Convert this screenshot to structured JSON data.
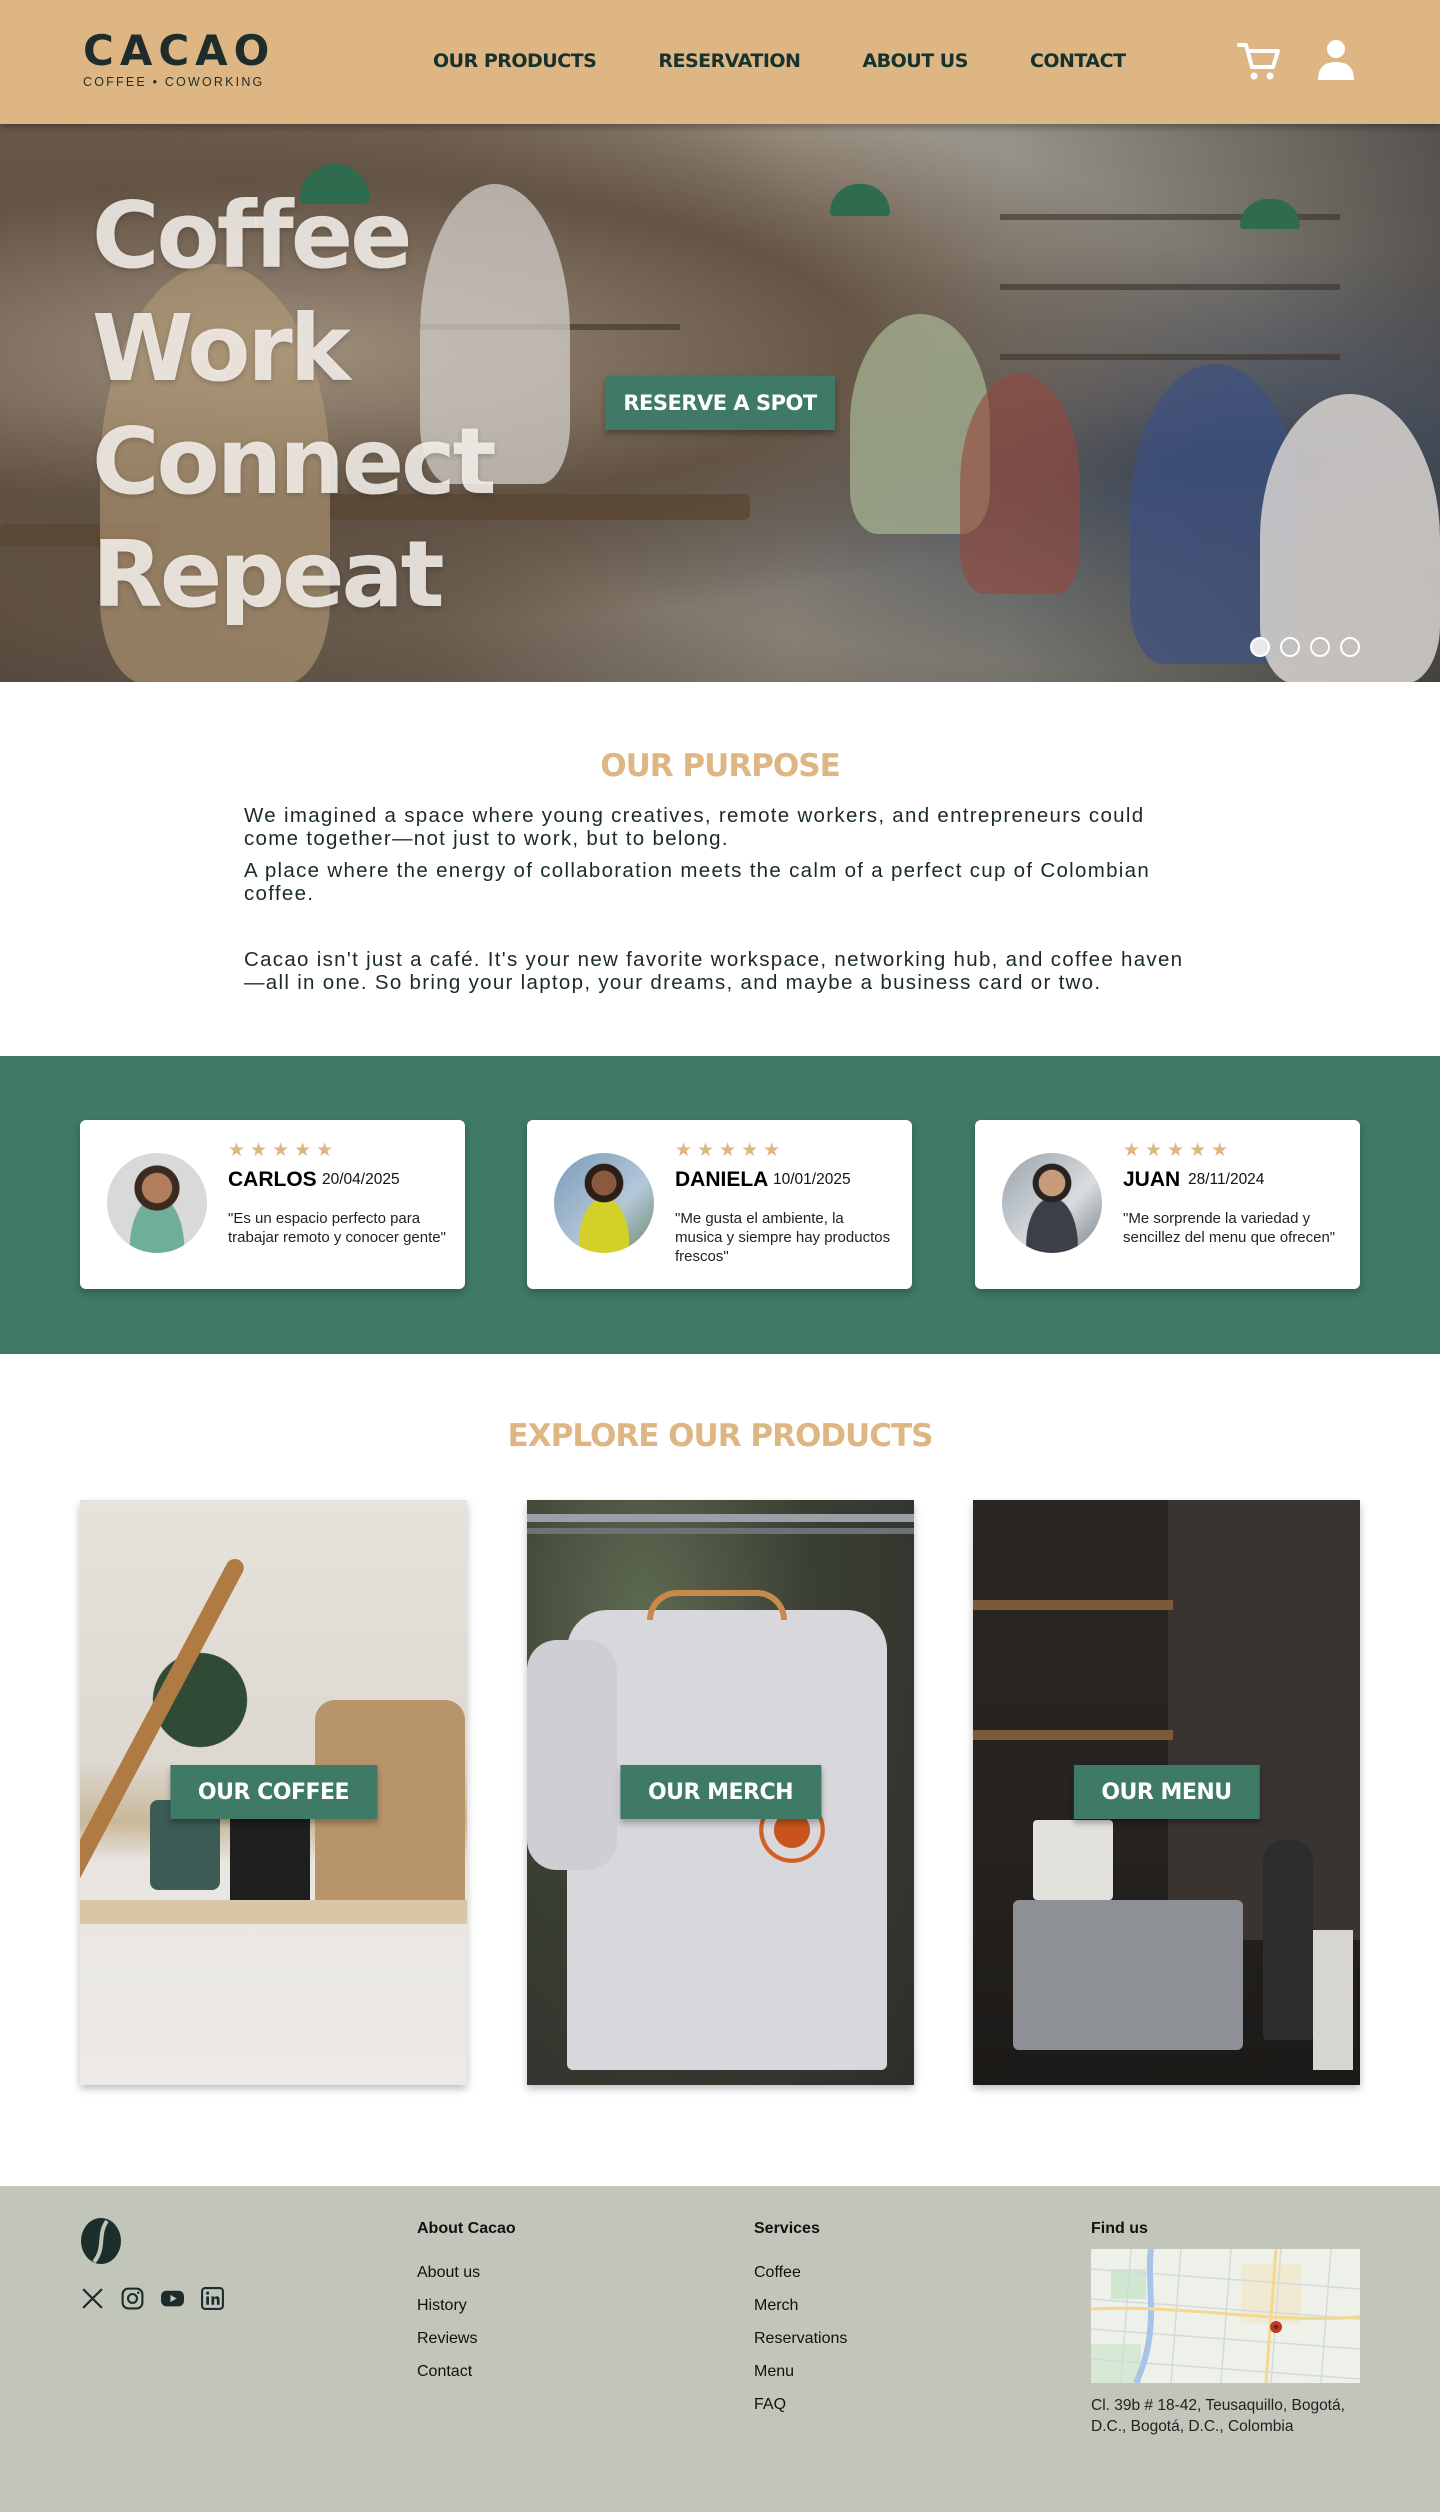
{
  "brand": {
    "name": "CACAO",
    "tagline": "COFFEE • COWORKING"
  },
  "nav": {
    "items": [
      "OUR PRODUCTS",
      "RESERVATION",
      "ABOUT US",
      "CONTACT"
    ]
  },
  "hero": {
    "words": [
      "Coffee",
      "Work",
      "Connect",
      "Repeat"
    ],
    "cta": "RESERVE A SPOT",
    "slides_total": 4,
    "active_slide": 1
  },
  "purpose": {
    "title": "OUR PURPOSE",
    "paragraphs": [
      "We imagined a space where young creatives, remote workers, and entrepreneurs could come together—not just to work, but to belong.",
      "A place where the energy of collaboration meets the calm of a perfect cup of Colombian coffee.",
      "Cacao isn't just a café. It's your new favorite workspace, networking hub, and coffee haven—all in one. So bring your laptop, your dreams, and maybe a business card or two."
    ]
  },
  "reviews": [
    {
      "name": "CARLOS",
      "date": "20/04/2025",
      "rating": 5,
      "text": "\"Es un espacio perfecto para trabajar remoto y conocer gente\""
    },
    {
      "name": "DANIELA",
      "date": "10/01/2025",
      "rating": 5,
      "text": "\"Me gusta el ambiente, la musica y siempre hay productos frescos\""
    },
    {
      "name": "JUAN",
      "date": "28/11/2024",
      "rating": 5,
      "text": "\"Me sorprende la variedad y sencillez del menu que ofrecen\""
    }
  ],
  "products": {
    "title": "EXPLORE OUR PRODUCTS",
    "items": [
      "OUR COFFEE",
      "OUR MERCH",
      "OUR MENU"
    ]
  },
  "footer": {
    "columns": [
      {
        "title": "About Cacao",
        "links": [
          "About us",
          "History",
          "Reviews",
          "Contact"
        ]
      },
      {
        "title": "Services",
        "links": [
          "Coffee",
          "Merch",
          "Reservations",
          "Menu",
          "FAQ"
        ]
      }
    ],
    "find_us": {
      "title": "Find us",
      "address": "Cl. 39b # 18-42, Teusaquillo, Bogotá, D.C., Bogotá, D.C., Colombia"
    },
    "socials": [
      "x-icon",
      "instagram-icon",
      "youtube-icon",
      "linkedin-icon"
    ]
  },
  "colors": {
    "header_bg": "#ddb683",
    "accent_green": "#3f7a67",
    "gold": "#ddb683",
    "footer_bg": "#c2c5ba"
  }
}
